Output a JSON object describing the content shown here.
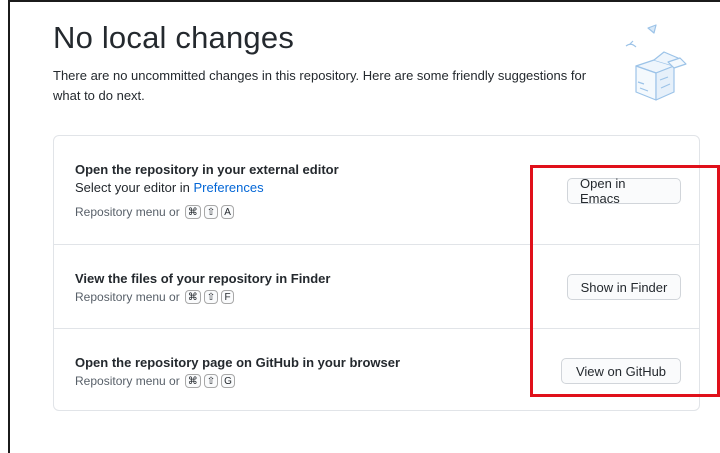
{
  "header": {
    "title": "No local changes",
    "subtitle": "There are no uncommitted changes in this repository. Here are some friendly suggestions for what to do next."
  },
  "actions": [
    {
      "title": "Open the repository in your external editor",
      "description_prefix": "Select your editor in ",
      "description_link": "Preferences",
      "hint": "Repository menu or",
      "keys": [
        "⌘",
        "⇧",
        "A"
      ],
      "button": "Open in Emacs"
    },
    {
      "title": "View the files of your repository in Finder",
      "hint": "Repository menu or",
      "keys": [
        "⌘",
        "⇧",
        "F"
      ],
      "button": "Show in Finder"
    },
    {
      "title": "Open the repository page on GitHub in your browser",
      "hint": "Repository menu or",
      "keys": [
        "⌘",
        "⇧",
        "G"
      ],
      "button": "View on GitHub"
    }
  ],
  "colors": {
    "link": "#0366d6",
    "annotation": "#e0101a"
  },
  "icons": [
    "paper-boxes-illustration"
  ]
}
